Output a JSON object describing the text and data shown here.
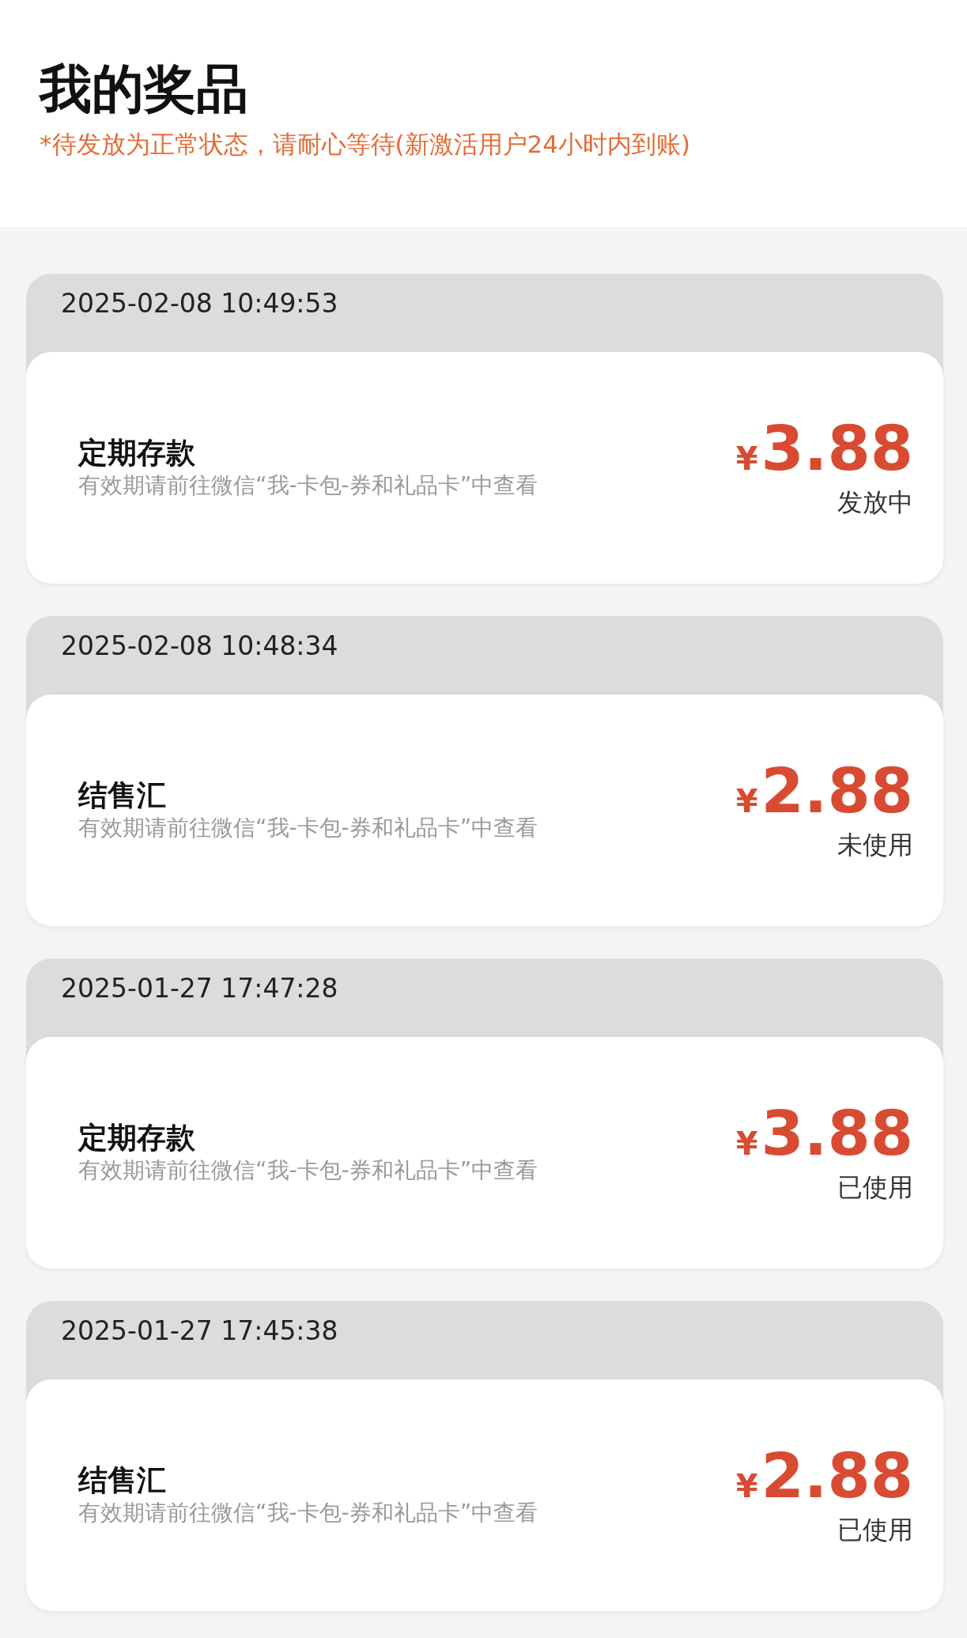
{
  "header": {
    "title": "我的奖品",
    "notice": "*待发放为正常状态，请耐心等待(新激活用户24小时内到账)"
  },
  "prizes": [
    {
      "time": "2025-02-08 10:49:53",
      "name": "定期存款",
      "note": "有效期请前往微信“我-卡包-券和礼品卡”中查看",
      "currency": "¥",
      "amount": "3.88",
      "status": "发放中"
    },
    {
      "time": "2025-02-08 10:48:34",
      "name": "结售汇",
      "note": "有效期请前往微信“我-卡包-券和礼品卡”中查看",
      "currency": "¥",
      "amount": "2.88",
      "status": "未使用"
    },
    {
      "time": "2025-01-27 17:47:28",
      "name": "定期存款",
      "note": "有效期请前往微信“我-卡包-券和礼品卡”中查看",
      "currency": "¥",
      "amount": "3.88",
      "status": "已使用"
    },
    {
      "time": "2025-01-27 17:45:38",
      "name": "结售汇",
      "note": "有效期请前往微信“我-卡包-券和礼品卡”中查看",
      "currency": "¥",
      "amount": "2.88",
      "status": "已使用"
    }
  ]
}
